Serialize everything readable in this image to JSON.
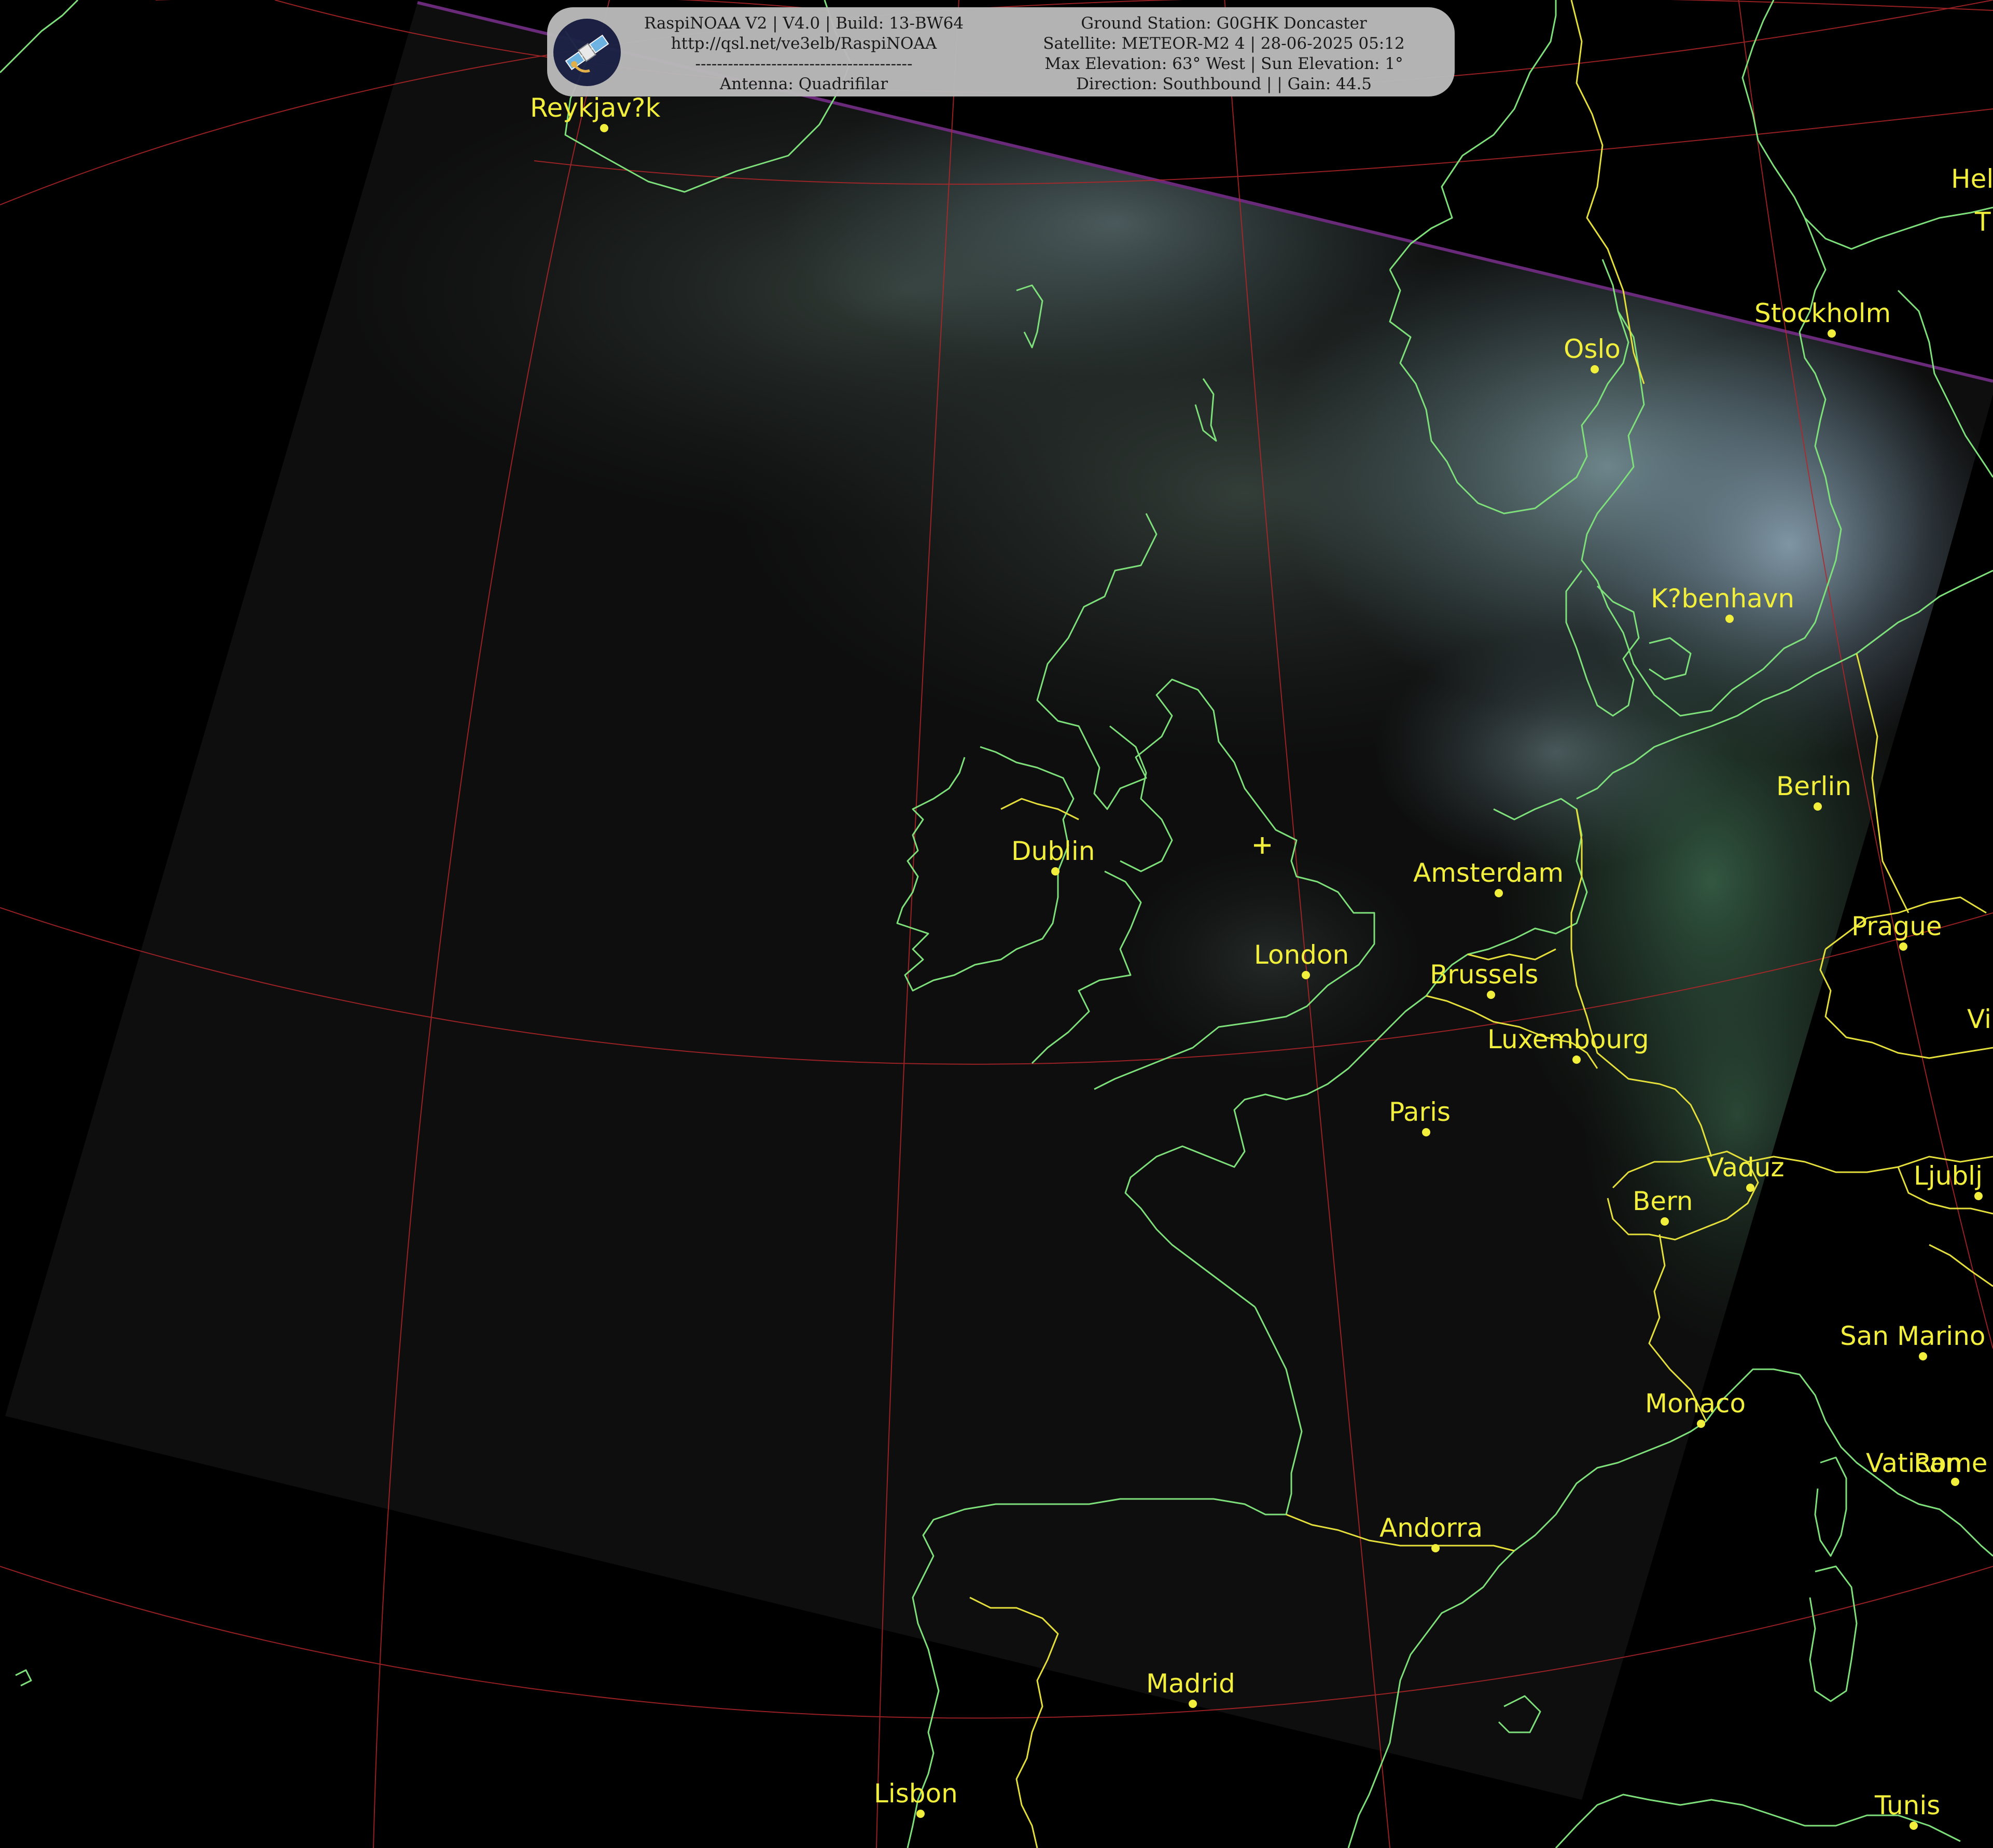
{
  "banner": {
    "left_lines": [
      "RaspiNOAA V2 | V4.0 | Build: 13-BW64",
      "http://qsl.net/ve3elb/RaspiNOAA",
      "----------------------------------------",
      "Antenna: Quadrifilar"
    ],
    "right_lines": [
      "Ground Station: G0GHK Doncaster",
      "Satellite: METEOR-M2 4 | 28-06-2025 05:12",
      "Max Elevation: 63° West | Sun Elevation: 1°",
      "Direction: Southbound | | Gain: 44.5"
    ],
    "logo_icon": "satellite-icon"
  },
  "cities": [
    {
      "id": "reykjavik",
      "name": "Reykjav?k"
    },
    {
      "id": "oslo",
      "name": "Oslo"
    },
    {
      "id": "stockholm",
      "name": "Stockholm"
    },
    {
      "id": "helsinki",
      "name": "Hel"
    },
    {
      "id": "tallinn",
      "name": "T"
    },
    {
      "id": "kobenhavn",
      "name": "K?benhavn"
    },
    {
      "id": "berlin",
      "name": "Berlin"
    },
    {
      "id": "dublin",
      "name": "Dublin"
    },
    {
      "id": "amsterdam",
      "name": "Amsterdam"
    },
    {
      "id": "london",
      "name": "London"
    },
    {
      "id": "prague",
      "name": "Prague"
    },
    {
      "id": "brussels",
      "name": "Brussels"
    },
    {
      "id": "vienna",
      "name": "Vi"
    },
    {
      "id": "luxembourg",
      "name": "Luxembourg"
    },
    {
      "id": "paris",
      "name": "Paris"
    },
    {
      "id": "vaduz",
      "name": "Vaduz"
    },
    {
      "id": "bern",
      "name": "Bern"
    },
    {
      "id": "ljubljana",
      "name": "Ljublj"
    },
    {
      "id": "san-marino",
      "name": "San Marino"
    },
    {
      "id": "monaco",
      "name": "Monaco"
    },
    {
      "id": "vatican",
      "name": "Vatican"
    },
    {
      "id": "rome",
      "name": "Rome"
    },
    {
      "id": "andorra",
      "name": "Andorra"
    },
    {
      "id": "madrid",
      "name": "Madrid"
    },
    {
      "id": "lisbon",
      "name": "Lisbon"
    },
    {
      "id": "tunis",
      "name": "Tunis"
    }
  ],
  "colors": {
    "label": "#f2ee3c",
    "coastline": "#7ee07a",
    "border": "#e4df3a",
    "graticule": "#b3262a",
    "background": "#000000",
    "banner": "#b9b9b9"
  }
}
